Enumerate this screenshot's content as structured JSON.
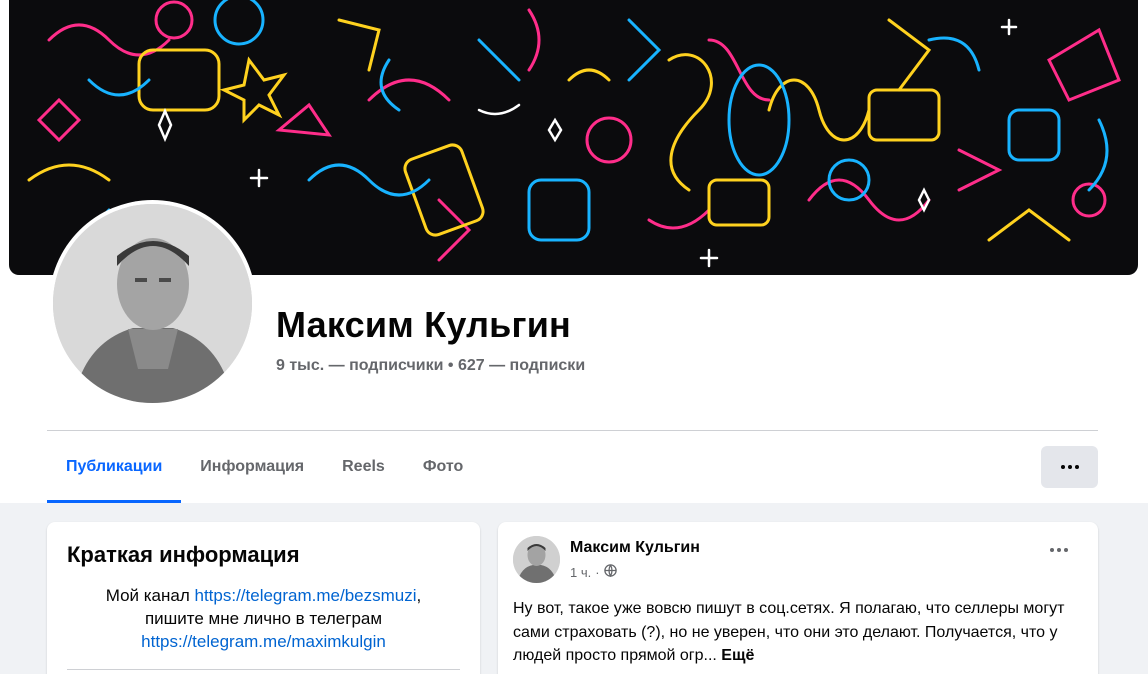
{
  "profile": {
    "name": "Максим Кульгин",
    "followers": "9 тыс. — подписчики",
    "stats_separator": "•",
    "following": "627 — подписки"
  },
  "tabs": [
    {
      "label": "Публикации",
      "active": true
    },
    {
      "label": "Информация",
      "active": false
    },
    {
      "label": "Reels",
      "active": false
    },
    {
      "label": "Фото",
      "active": false
    }
  ],
  "intro": {
    "title": "Краткая информация",
    "bio_prefix": "Мой канал ",
    "channel_link": "https://telegram.me/bezsmuzi",
    "bio_middle": ",\nпишите мне лично в телеграм",
    "personal_link": "https://telegram.me/maximkulgin"
  },
  "post": {
    "author": "Максим Кульгин",
    "time": "1 ч.",
    "dot": "·",
    "audience_icon": "globe-icon",
    "text": "Ну вот, такое уже вовсю пишут в соц.сетях. Я полагаю, что селлеры могут сами страховать (?), но не уверен, что они это делают. Получается, что у людей просто прямой огр... ",
    "more_label": "Ещё"
  },
  "colors": {
    "accent": "#0866ff",
    "link": "#0064d1",
    "muted": "#65676b",
    "cover_bg": "#0b0b0d"
  }
}
